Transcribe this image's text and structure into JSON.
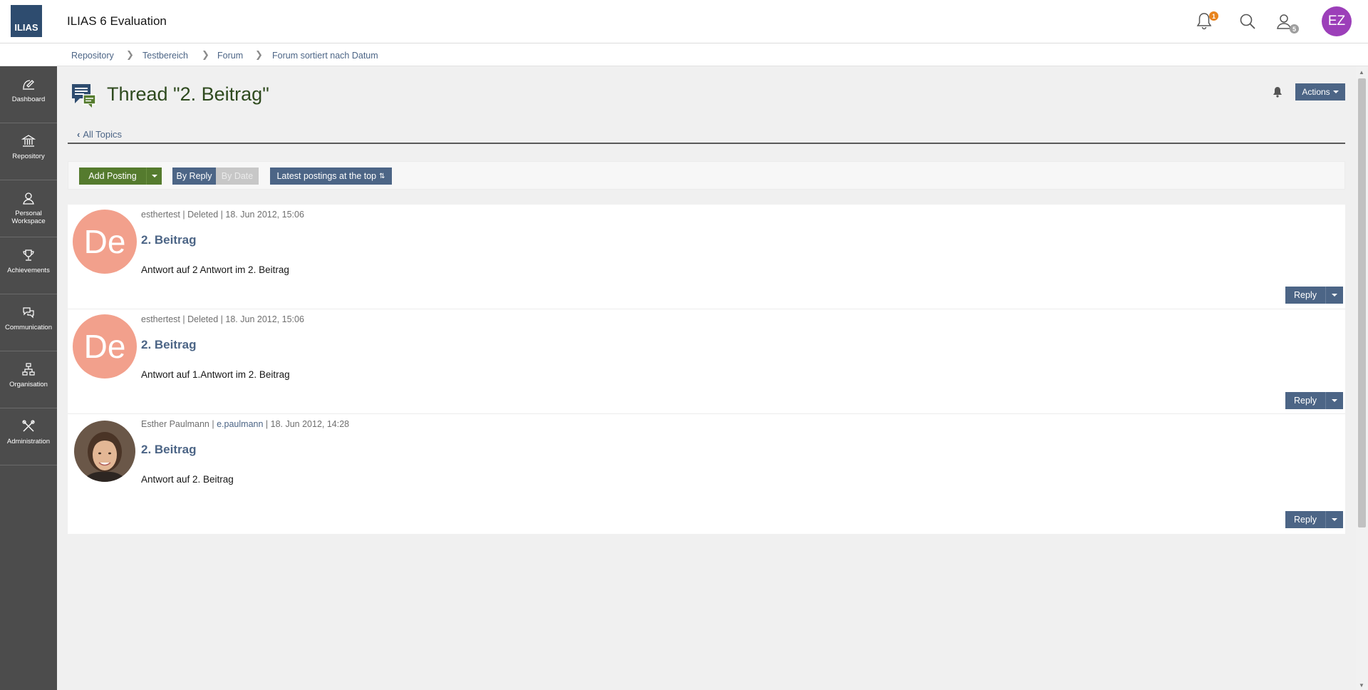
{
  "app": {
    "logo_text": "ILIAS",
    "title": "ILIAS 6 Evaluation"
  },
  "header": {
    "notification_count": "1",
    "contacts_count": "5",
    "user_initials": "EZ"
  },
  "breadcrumb": [
    "Repository",
    "Testbereich",
    "Forum",
    "Forum sortiert nach Datum"
  ],
  "sidebar": {
    "items": [
      {
        "label": "Dashboard",
        "icon": "dashboard-icon"
      },
      {
        "label": "Repository",
        "icon": "repository-icon"
      },
      {
        "label": "Personal Workspace",
        "icon": "person-icon"
      },
      {
        "label": "Achievements",
        "icon": "trophy-icon"
      },
      {
        "label": "Communication",
        "icon": "chat-icon"
      },
      {
        "label": "Organisation",
        "icon": "org-chart-icon"
      },
      {
        "label": "Administration",
        "icon": "tools-icon"
      }
    ]
  },
  "page": {
    "title": "Thread \"2. Beitrag\"",
    "actions_label": "Actions",
    "back_link": "All Topics"
  },
  "toolbar": {
    "add_posting": "Add Posting",
    "by_reply": "By Reply",
    "by_date": "By Date",
    "latest_top": "Latest postings at the top"
  },
  "posts": [
    {
      "author": "esthertest",
      "status": "Deleted",
      "date": "18. Jun 2012, 15:06",
      "avatar": "De",
      "title": "2. Beitrag",
      "text": "Antwort auf 2 Antwort im 2. Beitrag",
      "reply": "Reply"
    },
    {
      "author": "esthertest",
      "status": "Deleted",
      "date": "18. Jun 2012, 15:06",
      "avatar": "De",
      "title": "2. Beitrag",
      "text": "Antwort auf 1.Antwort im 2. Beitrag",
      "reply": "Reply"
    },
    {
      "author": "Esther Paulmann",
      "login": "e.paulmann",
      "date": "18. Jun 2012, 14:28",
      "title": "2. Beitrag",
      "text": "Antwort auf 2. Beitrag",
      "reply": "Reply"
    }
  ],
  "colors": {
    "primary": "#4c6586",
    "success": "#557b2e",
    "sidebar": "#4c4c4c",
    "avatar_deleted": "#f2a08c",
    "user_avatar": "#9c3fb9"
  }
}
